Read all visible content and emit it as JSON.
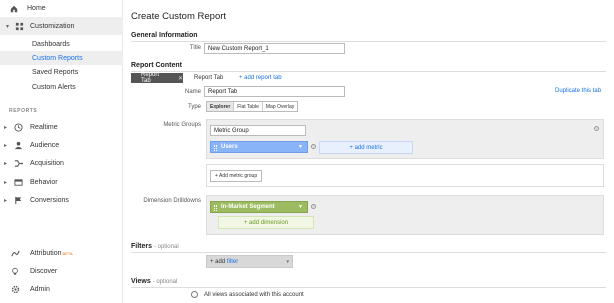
{
  "sidebar": {
    "home": "Home",
    "customization": "Customization",
    "sub_items": [
      "Dashboards",
      "Custom Reports",
      "Saved Reports",
      "Custom Alerts"
    ],
    "reports_label": "REPORTS",
    "report_items": [
      "Realtime",
      "Audience",
      "Acquisition",
      "Behavior",
      "Conversions"
    ],
    "attribution": "Attribution",
    "beta": "BETA",
    "discover": "Discover",
    "admin": "Admin"
  },
  "page": {
    "title": "Create Custom Report",
    "general_info": "General Information",
    "title_label": "Title",
    "title_value": "New Custom Report_1",
    "report_content": "Report Content",
    "tabs": [
      "Report Tab",
      "Report Tab"
    ],
    "add_tab": "+ add report tab",
    "name_label": "Name",
    "name_value": "Report Tab",
    "duplicate": "Duplicate this tab",
    "type_label": "Type",
    "types": [
      "Explorer",
      "Flat Table",
      "Map Overlay"
    ],
    "metric_groups_label": "Metric Groups",
    "metric_group_value": "Metric Group",
    "metric_chip": "Users",
    "add_metric": "+ add metric",
    "add_metric_group": "+ Add metric group",
    "dimension_label": "Dimension Drilldowns",
    "dimension_chip": "In-Market Segment",
    "add_dimension": "+ add dimension",
    "filters_title": "Filters",
    "optional": "- optional",
    "add_filter_prefix": "+ add",
    "add_filter_word": "filter",
    "views_title": "Views",
    "views_option": "All views associated with this account"
  },
  "colors": {
    "accent_blue": "#1a73e8",
    "metric_chip": "#8ab4f8",
    "dimension_chip": "#9dbb61",
    "active_tab": "#555555"
  }
}
